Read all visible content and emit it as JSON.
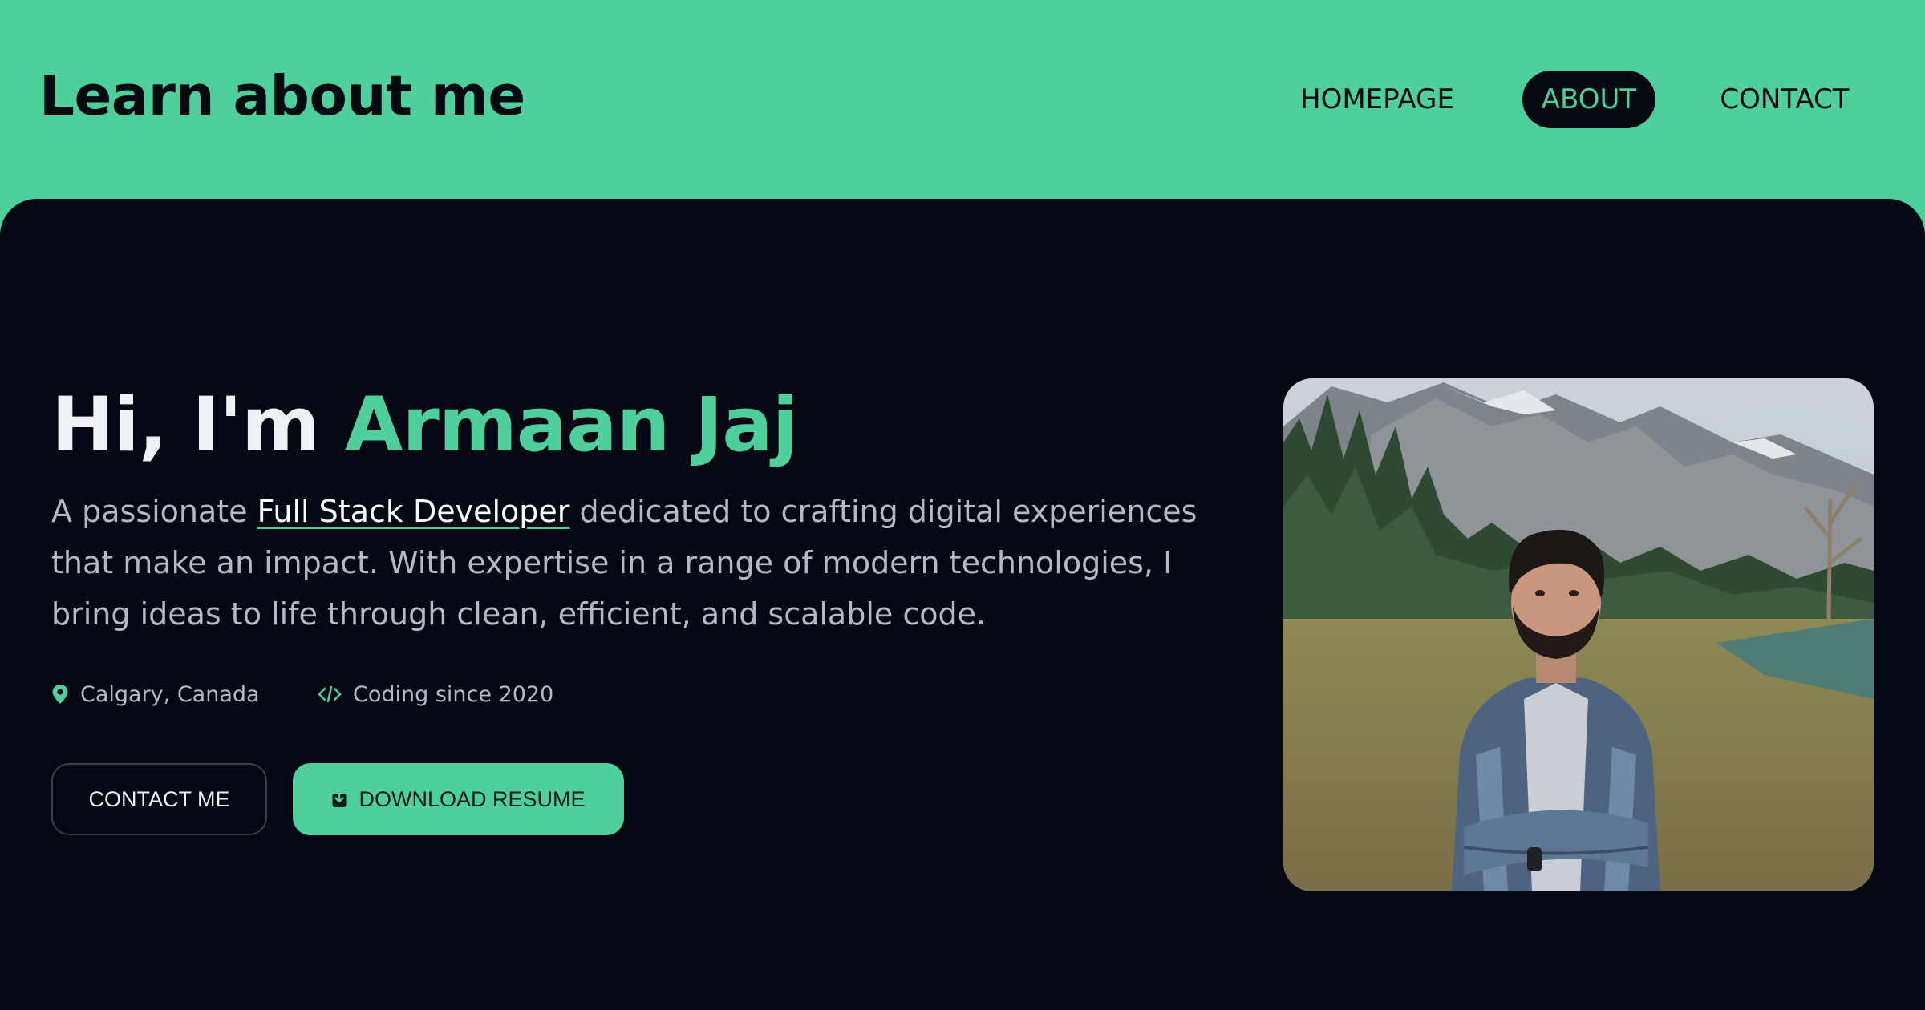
{
  "header": {
    "title": "Learn about me",
    "nav": {
      "home": "HOMEPAGE",
      "about": "ABOUT",
      "contact": "CONTACT"
    }
  },
  "hero": {
    "greeting": "Hi, I'm ",
    "name": "Armaan Jaj",
    "intro_before": "A passionate ",
    "intro_highlight": "Full Stack Developer",
    "intro_after": " dedicated to crafting digital experiences that make an impact. With expertise in a range of modern technologies, I bring ideas to life through clean, efficient, and scalable code.",
    "location": "Calgary, Canada",
    "coding_since": "Coding since 2020",
    "contact_button": "CONTACT ME",
    "resume_button": "DOWNLOAD RESUME"
  },
  "icons": {
    "location": "map-pin-icon",
    "code": "code-icon",
    "download": "download-icon"
  },
  "colors": {
    "accent": "#4ecf9b",
    "background": "#050713",
    "text": "#f0f1f4",
    "muted": "#b6b9c4"
  }
}
